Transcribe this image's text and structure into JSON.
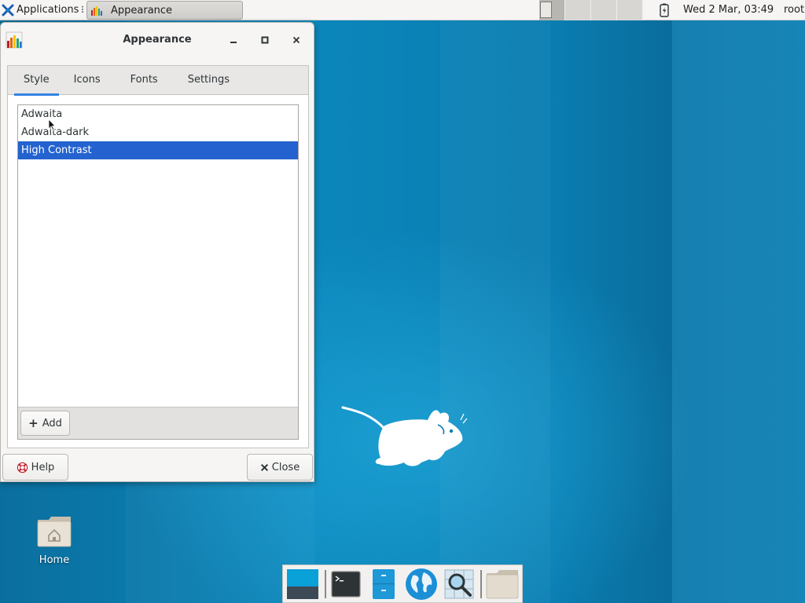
{
  "top_panel": {
    "applications_label": "Applications",
    "task_title": "Appearance",
    "clock": "Wed  2 Mar, 03:49",
    "user": "root"
  },
  "window": {
    "title": "Appearance",
    "tabs": [
      {
        "label": "Style",
        "active": true
      },
      {
        "label": "Icons",
        "active": false
      },
      {
        "label": "Fonts",
        "active": false
      },
      {
        "label": "Settings",
        "active": false
      }
    ],
    "themes": [
      {
        "name": "Adwaita",
        "selected": false
      },
      {
        "name": "Adwaita-dark",
        "selected": false
      },
      {
        "name": "High Contrast",
        "selected": true
      }
    ],
    "add_label": "Add",
    "help_label": "Help",
    "close_label": "Close"
  },
  "desktop": {
    "home_label": "Home"
  },
  "dock": {
    "items": [
      "show-desktop-icon",
      "terminal-icon",
      "file-cabinet-icon",
      "web-browser-icon",
      "app-finder-icon",
      "folder-icon"
    ]
  },
  "colors": {
    "selection": "#2463cf",
    "tab_underline": "#3584e4",
    "desktop_blue": "#0a7fb3"
  }
}
